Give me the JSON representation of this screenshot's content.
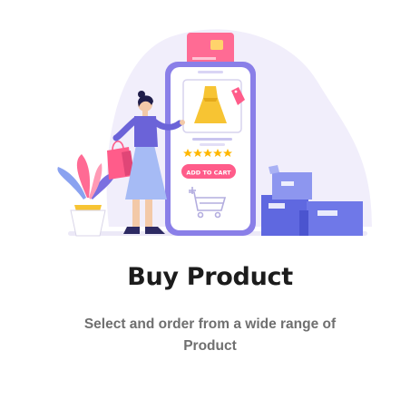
{
  "illustration": {
    "add_to_cart_label": "ADD TO CART",
    "rating_stars": 5,
    "icons": [
      "dress-icon",
      "price-tag-icon",
      "shopping-cart-icon",
      "credit-card-icon",
      "shopping-bag-icon",
      "plant-icon",
      "boxes-icon"
    ],
    "colors": {
      "accent_pink": "#ff5c8a",
      "phone_purple": "#8a7fe8",
      "dress_yellow": "#f7c433",
      "box_blue": "#6f78e8",
      "backdrop": "#f1eefb"
    }
  },
  "title": "Buy Product",
  "subtitle": "Select and order from a wide range of Product"
}
